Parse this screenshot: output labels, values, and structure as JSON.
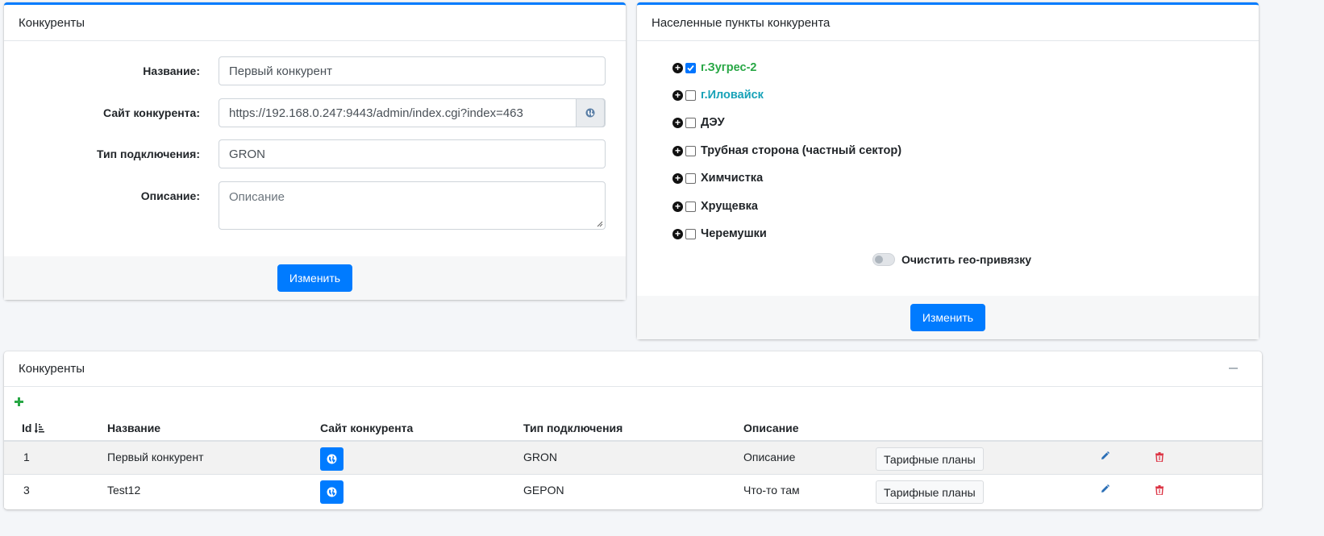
{
  "competitor_form": {
    "header": "Конкуренты",
    "fields": [
      {
        "label": "Название:",
        "value": "Первый конкурент"
      },
      {
        "label": "Сайт конкурента:",
        "value": "https://192.168.0.247:9443/admin/index.cgi?index=463"
      },
      {
        "label": "Тип подключения:",
        "value": "GRON"
      },
      {
        "label": "Описание:",
        "placeholder": "Описание"
      }
    ],
    "submit_label": "Изменить"
  },
  "locations": {
    "header": "Населенные пункты конкурента",
    "items": [
      {
        "label": "г.Зугрес-2",
        "checked": true,
        "color": "#28a745"
      },
      {
        "label": "г.Иловайск",
        "checked": false,
        "color": "#17a2b8"
      },
      {
        "label": "ДЭУ",
        "checked": false,
        "color": "#212529"
      },
      {
        "label": "Трубная сторона (частный сектор)",
        "checked": false,
        "color": "#212529"
      },
      {
        "label": "Химчистка",
        "checked": false,
        "color": "#212529"
      },
      {
        "label": "Хрущевка",
        "checked": false,
        "color": "#212529"
      },
      {
        "label": "Черемушки",
        "checked": false,
        "color": "#212529"
      }
    ],
    "toggle_label": "Очистить гео-привязку",
    "submit_label": "Изменить"
  },
  "table_card": {
    "header": "Конкуренты",
    "columns": [
      "Id",
      "Название",
      "Сайт конкурента",
      "Тип подключения",
      "Описание"
    ],
    "rows": [
      {
        "id": "1",
        "name": "Первый конкурент",
        "type": "GRON",
        "description": "Описание",
        "tariff_label": "Тарифные планы"
      },
      {
        "id": "3",
        "name": "Test12",
        "type": "GEPON",
        "description": "Что-то там",
        "tariff_label": "Тарифные планы"
      }
    ]
  },
  "colors": {
    "accent": "#007bff",
    "success": "#28a745",
    "info": "#17a2b8",
    "danger": "#dc3545"
  },
  "icons": [
    "globe-icon",
    "plus-circle-icon",
    "add-icon",
    "collapse-icon",
    "sort-icon",
    "edit-icon",
    "trash-icon"
  ]
}
